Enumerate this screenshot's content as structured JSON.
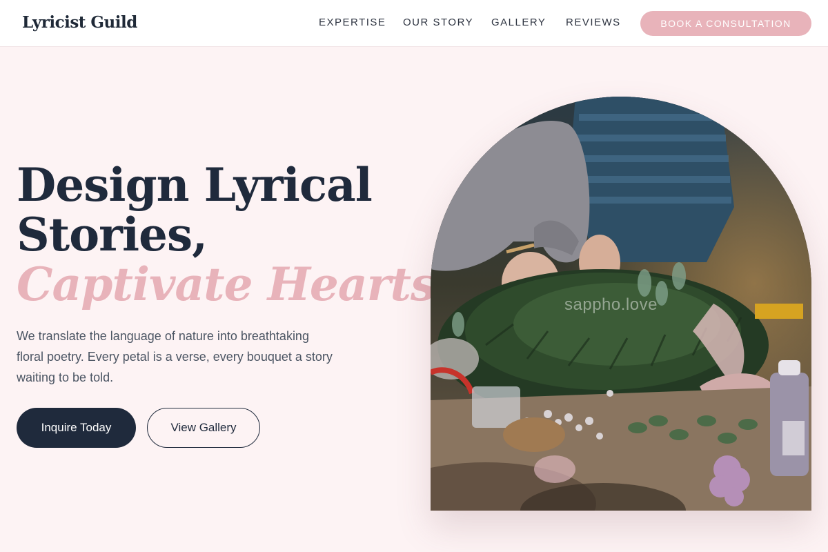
{
  "brand": {
    "name": "Lyricist Guild"
  },
  "nav": {
    "links": [
      {
        "label": "EXPERTISE"
      },
      {
        "label": "OUR STORY"
      },
      {
        "label": "GALLERY"
      },
      {
        "label": "REVIEWS"
      }
    ],
    "cta_label": "BOOK A CONSULTATION"
  },
  "hero": {
    "headline_line1": "Design Lyrical",
    "headline_line2": "Stories,",
    "headline_accent": "Captivate Hearts.",
    "tagline": "We translate the language of nature into breathtaking floral poetry. Every petal is a verse, every bouquet a story waiting to be told.",
    "primary_button": "Inquire Today",
    "secondary_button": "View Gallery",
    "image_watermark": "sappho.love",
    "image_icon": "wreath-making-photo"
  },
  "colors": {
    "accent": "#e8b3ba",
    "navy": "#1f2a3c",
    "background": "#fdf3f4"
  }
}
